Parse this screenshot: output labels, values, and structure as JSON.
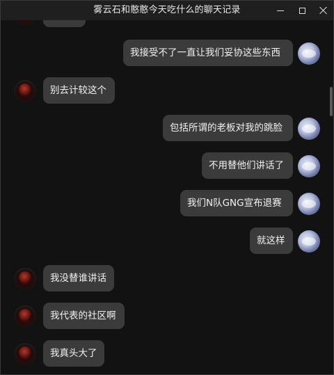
{
  "window": {
    "title": "雾云石和憨憨今天吃什么的聊天记录"
  },
  "chat": {
    "messages": [
      {
        "side": "left",
        "text": ""
      },
      {
        "side": "right",
        "text": "我接受不了一直让我们妥协这些东西"
      },
      {
        "side": "left",
        "text": "别去计较这个"
      },
      {
        "side": "right",
        "text": "包括所谓的老板对我的跳脸"
      },
      {
        "side": "right",
        "text": "不用替他们讲话了"
      },
      {
        "side": "right",
        "text": "我们N队GNG宣布退赛"
      },
      {
        "side": "right",
        "text": "就这样"
      },
      {
        "side": "left",
        "text": "我没替谁讲话"
      },
      {
        "side": "left",
        "text": "我代表的社区啊"
      },
      {
        "side": "left",
        "text": "我真头大了"
      }
    ]
  }
}
